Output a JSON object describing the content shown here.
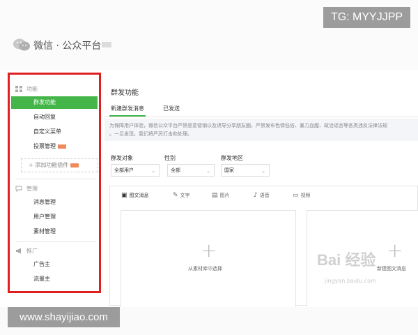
{
  "watermarks": {
    "tg": "TG: MYYJJPP",
    "site": "www.shayijiao.com",
    "baidu": "Bai 经验",
    "baidu_sub": "jingyan.baidu.com"
  },
  "header": {
    "brand": "微信 · 公众平台"
  },
  "sidebar": {
    "sections": [
      {
        "title": "功能",
        "icon": "grid-icon"
      },
      {
        "title": "管理",
        "icon": "speech-bubble-icon"
      },
      {
        "title": "推广",
        "icon": "megaphone-icon"
      }
    ],
    "function_items": [
      "群发功能",
      "自动回复",
      "自定义菜单",
      "投票管理"
    ],
    "add_plugin": "+ 添加功能插件",
    "manage_items": [
      "消息管理",
      "用户管理",
      "素材管理"
    ],
    "promo_items": [
      "广告主",
      "流量主"
    ]
  },
  "main": {
    "title": "群发功能",
    "tabs": [
      "新建群发消息",
      "已发送"
    ],
    "notice": "为保障用户体验，微信公众平台严禁恶意营销以及诱导分享朋友圈，严禁发布色情低俗、暴力血腥、政治谣言等各类违反法律法规",
    "notice2": "。一旦发现，我们将严厉打击和处理。",
    "filters": [
      {
        "label": "群发对象",
        "value": "全部用户"
      },
      {
        "label": "性别",
        "value": "全部"
      },
      {
        "label": "群发地区",
        "value": "国家"
      }
    ],
    "editor_tools": [
      {
        "label": "图文消息",
        "icon": "article-icon"
      },
      {
        "label": "文字",
        "icon": "pencil-icon"
      },
      {
        "label": "图片",
        "icon": "image-icon"
      },
      {
        "label": "语音",
        "icon": "mic-icon"
      },
      {
        "label": "视频",
        "icon": "video-icon"
      }
    ],
    "cards": [
      "从素材库中选择",
      "新建图文消息"
    ]
  },
  "colors": {
    "accent": "#44b549",
    "highlight_border": "#e02020"
  }
}
